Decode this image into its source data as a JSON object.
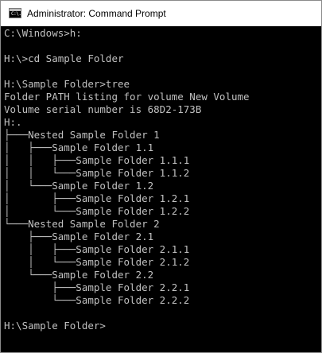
{
  "window": {
    "title": "Administrator: Command Prompt",
    "icon": "cmd-icon",
    "icon_text": "C:\\."
  },
  "console": {
    "text_color": "#c0c0c0",
    "background": "#000000",
    "lines": [
      "C:\\Windows>h:",
      "",
      "H:\\>cd Sample Folder",
      "",
      "H:\\Sample Folder>tree",
      "Folder PATH listing for volume New Volume",
      "Volume serial number is 68D2-173B",
      "H:.",
      "├───Nested Sample Folder 1",
      "│   ├───Sample Folder 1.1",
      "│   │   ├───Sample Folder 1.1.1",
      "│   │   └───Sample Folder 1.1.2",
      "│   └───Sample Folder 1.2",
      "│       ├───Sample Folder 1.2.1",
      "│       └───Sample Folder 1.2.2",
      "└───Nested Sample Folder 2",
      "    ├───Sample Folder 2.1",
      "    │   ├───Sample Folder 2.1.1",
      "    │   └───Sample Folder 2.1.2",
      "    └───Sample Folder 2.2",
      "        ├───Sample Folder 2.2.1",
      "        └───Sample Folder 2.2.2",
      "",
      "H:\\Sample Folder>"
    ]
  }
}
